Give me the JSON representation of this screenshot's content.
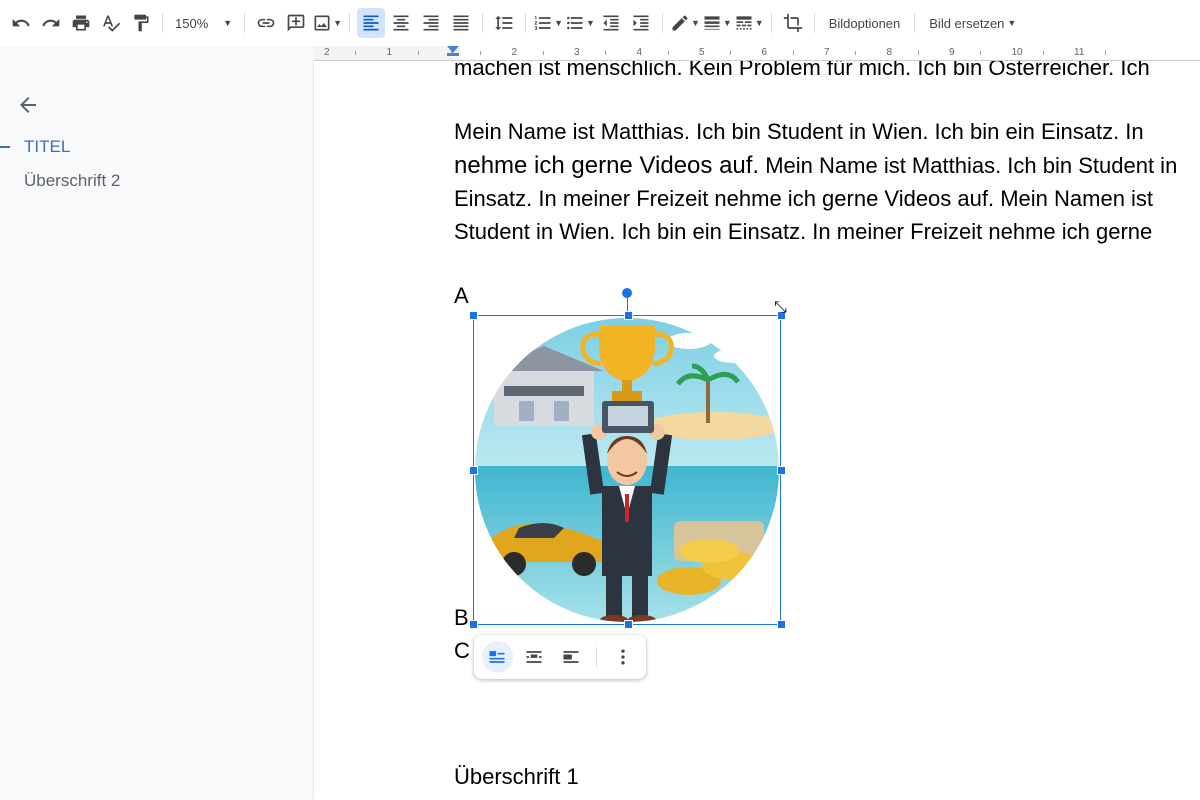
{
  "toolbar": {
    "zoom": "150%",
    "image_options_label": "Bildoptionen",
    "replace_image_label": "Bild ersetzen"
  },
  "ruler": {
    "labels": [
      "2",
      "1",
      "1",
      "2",
      "3",
      "4",
      "5",
      "6",
      "7",
      "8",
      "9",
      "10",
      "11"
    ]
  },
  "outline": {
    "h1": "TITEL",
    "h2": "Überschrift 2"
  },
  "document": {
    "line0": "machen ist menschlich. Kein Problem für mich. Ich bin Österreicher. Ich",
    "line1": "Mein Name ist Matthias. Ich bin Student in Wien. Ich bin ein Einsatz. In",
    "line2_big": "nehme ich gerne Videos auf.",
    "line2_rest": " Mein Name ist Matthias. Ich bin Student in",
    "line3": "Einsatz. In meiner Freizeit nehme ich gerne Videos auf. Mein Namen ist",
    "line4": "Student in Wien. Ich bin ein Einsatz. In meiner Freizeit nehme ich gerne",
    "letter_a": "A",
    "letter_b": "B",
    "letter_c": "C",
    "heading": "Überschrift 1"
  },
  "colors": {
    "accent": "#1a73e8",
    "outline_active": "#3b6fb6"
  }
}
